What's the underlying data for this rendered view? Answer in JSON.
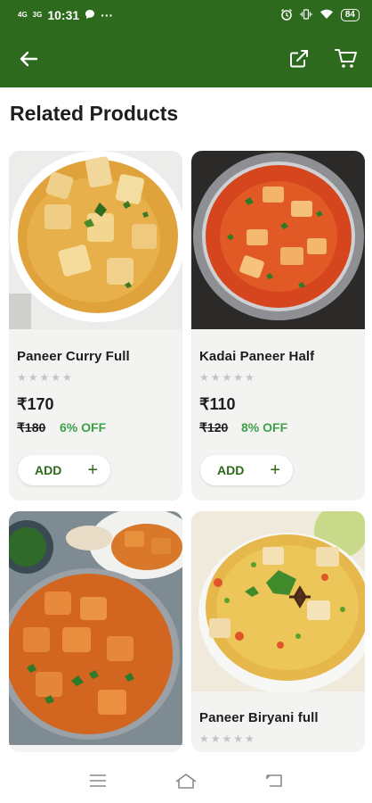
{
  "status": {
    "time": "10:31",
    "signal1": "4G",
    "signal2": "3G",
    "battery": "84",
    "more": "···"
  },
  "page": {
    "title": "Related Products"
  },
  "products": [
    {
      "name": "Paneer Curry Full",
      "stars": "★★★★★",
      "price": "₹170",
      "old_price": "₹180",
      "discount": "6% OFF",
      "add_label": "ADD",
      "plus": "+"
    },
    {
      "name": "Kadai Paneer Half",
      "stars": "★★★★★",
      "price": "₹110",
      "old_price": "₹120",
      "discount": "8% OFF",
      "add_label": "ADD",
      "plus": "+"
    },
    {
      "name": "",
      "stars": ""
    },
    {
      "name": "Paneer Biryani full",
      "stars": "★★★★★"
    }
  ],
  "colors": {
    "brand": "#2d6a1d",
    "discount": "#3ea14a"
  }
}
